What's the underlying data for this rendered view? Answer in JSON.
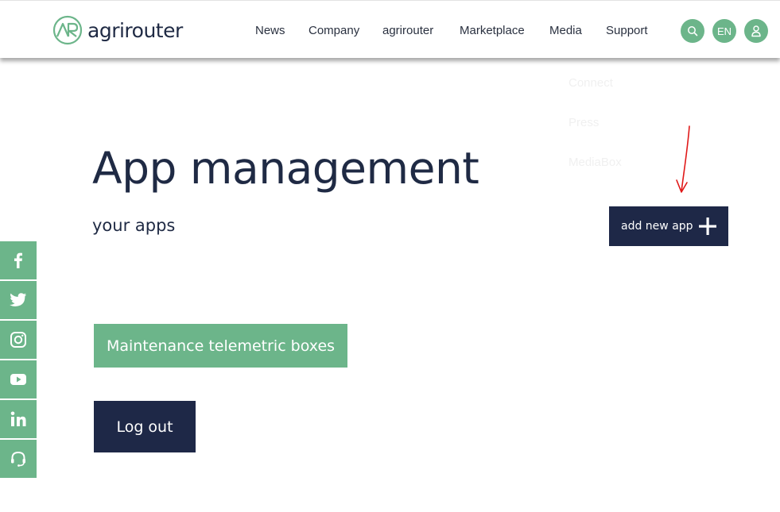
{
  "header": {
    "logo_text": "agrirouter",
    "nav": [
      "News",
      "Company",
      "agrirouter",
      "Marketplace",
      "Media",
      "Support"
    ],
    "language_label": "EN"
  },
  "dropdown": {
    "items": [
      "Connect",
      "Press",
      "MediaBox"
    ]
  },
  "main": {
    "title": "App management",
    "subtitle": "your apps",
    "add_app_label": "add new app",
    "maintenance_label": "Maintenance telemetric boxes",
    "logout_label": "Log out"
  },
  "social": {
    "icons": [
      "facebook-icon",
      "twitter-icon",
      "instagram-icon",
      "youtube-icon",
      "linkedin-icon",
      "headset-icon"
    ]
  },
  "colors": {
    "brand_green": "#6cb58a",
    "navy": "#1e2847",
    "text_dark": "#1f2a44",
    "annotation_red": "#e01818"
  }
}
